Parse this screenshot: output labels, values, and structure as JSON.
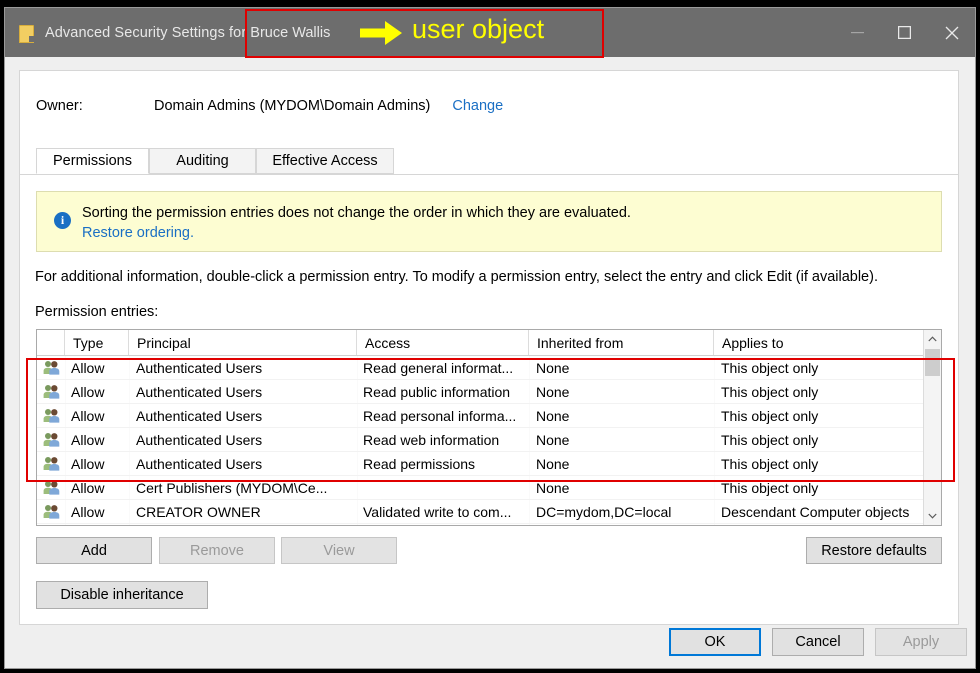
{
  "window": {
    "title_prefix": "Advanced Security Settings for",
    "subject": "Bruce Wallis",
    "icon": "folder-icon",
    "controls": {
      "minimize": "minimize-icon",
      "maximize": "maximize-icon",
      "close": "close-icon"
    }
  },
  "owner": {
    "label": "Owner:",
    "value": "Domain Admins (MYDOM\\Domain Admins)",
    "change_link": "Change"
  },
  "tabs": [
    {
      "label": "Permissions",
      "active": true
    },
    {
      "label": "Auditing",
      "active": false
    },
    {
      "label": "Effective Access",
      "active": false
    }
  ],
  "info_bar": {
    "icon": "info-icon",
    "message": "Sorting the permission entries does not change the order in which they are evaluated.",
    "link": "Restore ordering."
  },
  "instructions": "For additional information, double-click a permission entry. To modify a permission entry, select the entry and click Edit (if available).",
  "entries_label": "Permission entries:",
  "table": {
    "columns": [
      "Type",
      "Principal",
      "Access",
      "Inherited from",
      "Applies to"
    ],
    "rows": [
      {
        "icon": "users-group-icon",
        "type": "Allow",
        "principal": "Authenticated Users",
        "access": "Read general informat...",
        "inherited_from": "None",
        "applies_to": "This object only"
      },
      {
        "icon": "users-group-icon",
        "type": "Allow",
        "principal": "Authenticated Users",
        "access": "Read public information",
        "inherited_from": "None",
        "applies_to": "This object only"
      },
      {
        "icon": "users-group-icon",
        "type": "Allow",
        "principal": "Authenticated Users",
        "access": "Read personal informa...",
        "inherited_from": "None",
        "applies_to": "This object only"
      },
      {
        "icon": "users-group-icon",
        "type": "Allow",
        "principal": "Authenticated Users",
        "access": "Read web information",
        "inherited_from": "None",
        "applies_to": "This object only"
      },
      {
        "icon": "users-group-icon",
        "type": "Allow",
        "principal": "Authenticated Users",
        "access": "Read permissions",
        "inherited_from": "None",
        "applies_to": "This object only"
      },
      {
        "icon": "users-group-icon",
        "type": "Allow",
        "principal": "Cert Publishers (MYDOM\\Ce...",
        "access": "",
        "inherited_from": "None",
        "applies_to": "This object only"
      },
      {
        "icon": "users-group-icon",
        "type": "Allow",
        "principal": "CREATOR OWNER",
        "access": "Validated write to com...",
        "inherited_from": "DC=mydom,DC=local",
        "applies_to": "Descendant Computer objects"
      }
    ]
  },
  "scrollbar": {
    "up_arrow": "chevron-up-icon",
    "down_arrow": "chevron-down-icon"
  },
  "buttons": {
    "add": "Add",
    "remove": "Remove",
    "view": "View",
    "restore_defaults": "Restore defaults",
    "disable_inheritance": "Disable inheritance",
    "ok": "OK",
    "cancel": "Cancel",
    "apply": "Apply"
  },
  "annotation": {
    "label": "user object",
    "arrow": "right-arrow-icon",
    "text_color": "#ffff00",
    "box_color": "#e00000"
  }
}
